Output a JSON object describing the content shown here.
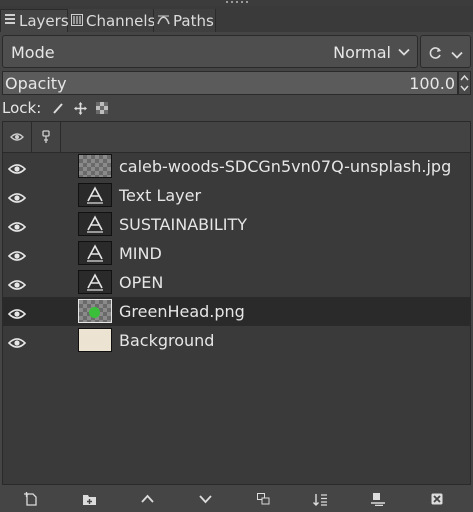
{
  "tabs": [
    {
      "label": "Layers",
      "icon": "layers-icon",
      "active": true
    },
    {
      "label": "Channels",
      "icon": "channels-icon",
      "active": false
    },
    {
      "label": "Paths",
      "icon": "paths-icon",
      "active": false
    }
  ],
  "mode": {
    "label": "Mode",
    "value": "Normal"
  },
  "opacity": {
    "label": "Opacity",
    "value": "100.0"
  },
  "lock": {
    "label": "Lock:"
  },
  "layers": [
    {
      "name": "caleb-woods-SDCGn5vn07Q-unsplash.jpg",
      "thumb": "checker",
      "visible": true,
      "selected": false
    },
    {
      "name": "Text Layer",
      "thumb": "text",
      "visible": true,
      "selected": false
    },
    {
      "name": "SUSTAINABILITY",
      "thumb": "text",
      "visible": true,
      "selected": false
    },
    {
      "name": "MIND",
      "thumb": "text",
      "visible": true,
      "selected": false
    },
    {
      "name": "OPEN",
      "thumb": "text",
      "visible": true,
      "selected": false
    },
    {
      "name": "GreenHead.png",
      "thumb": "green",
      "visible": true,
      "selected": true
    },
    {
      "name": "Background",
      "thumb": "solid",
      "visible": true,
      "selected": false
    }
  ],
  "colors": {
    "background_fill": "#ece3d2",
    "green_head": "#3bbf3b",
    "selected_row": "#2a2a2a"
  }
}
